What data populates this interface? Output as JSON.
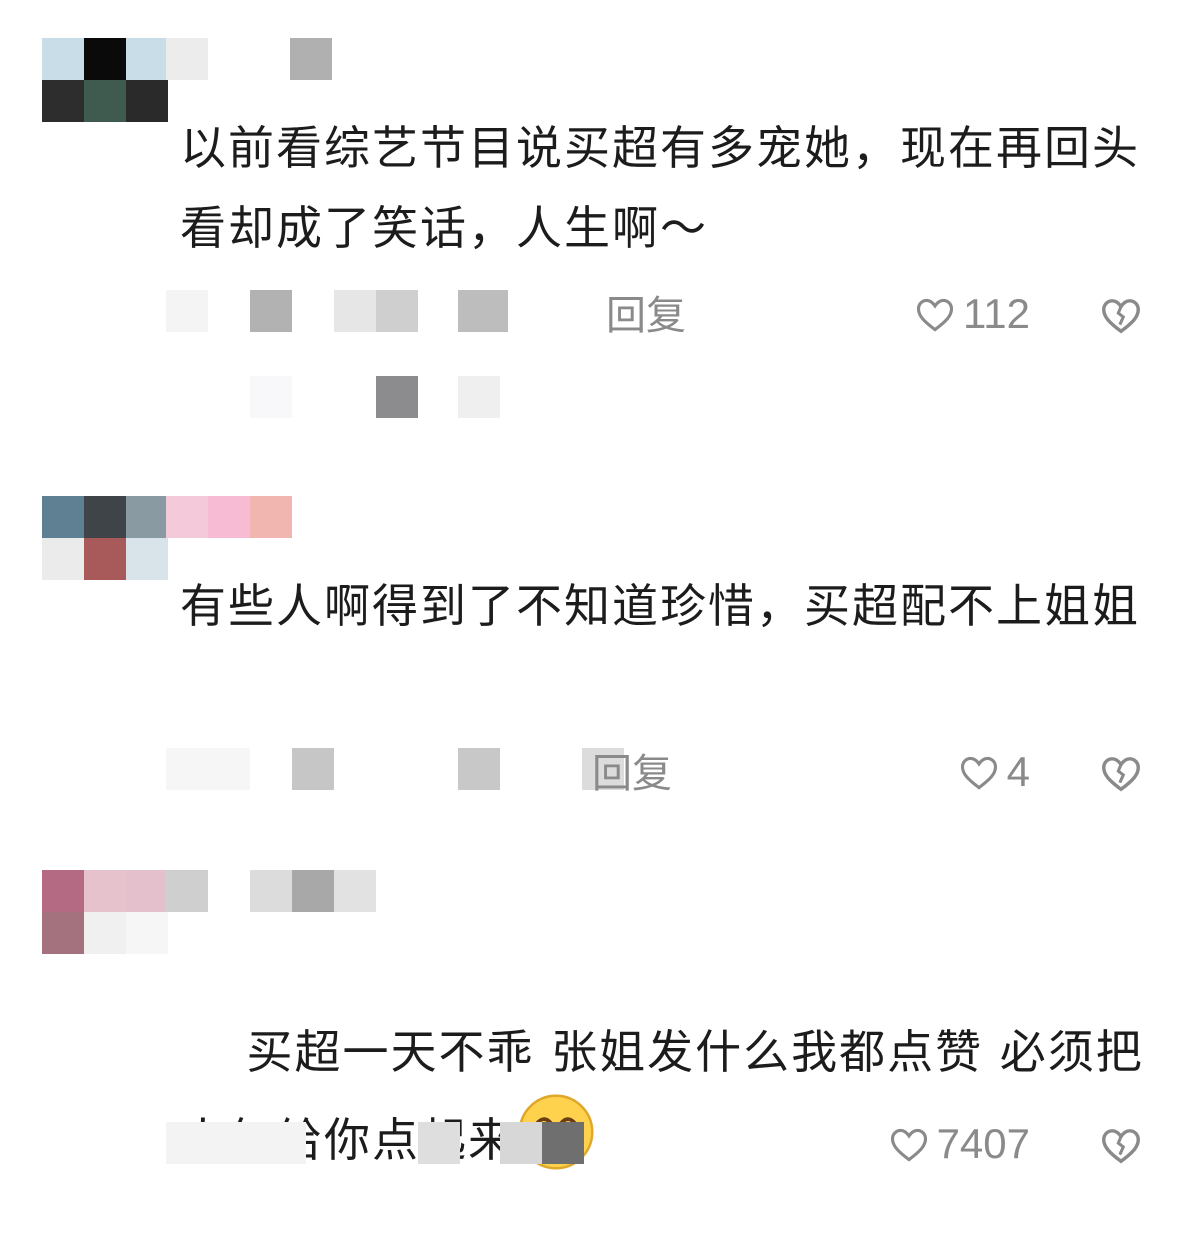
{
  "comments": [
    {
      "text": "以前看综艺节目说买超有多宠她，现在再回头看却成了笑话，人生啊～",
      "reply_label": "回复",
      "likes": "112"
    },
    {
      "text": "有些人啊得到了不知道珍惜，买超配不上姐姐",
      "reply_label": "回复",
      "likes": "4"
    },
    {
      "text": "买超一天不乖 张姐发什么我都点赞 必须把人气给你点起来",
      "reply_label": "",
      "likes": "7407",
      "emoji": "grinning-face-icon"
    }
  ],
  "icons": {
    "like": "heart-outline-icon",
    "dislike": "broken-heart-icon"
  },
  "colors": {
    "text": "#1c1c1c",
    "meta": "#8a8a8a",
    "background": "#ffffff"
  }
}
